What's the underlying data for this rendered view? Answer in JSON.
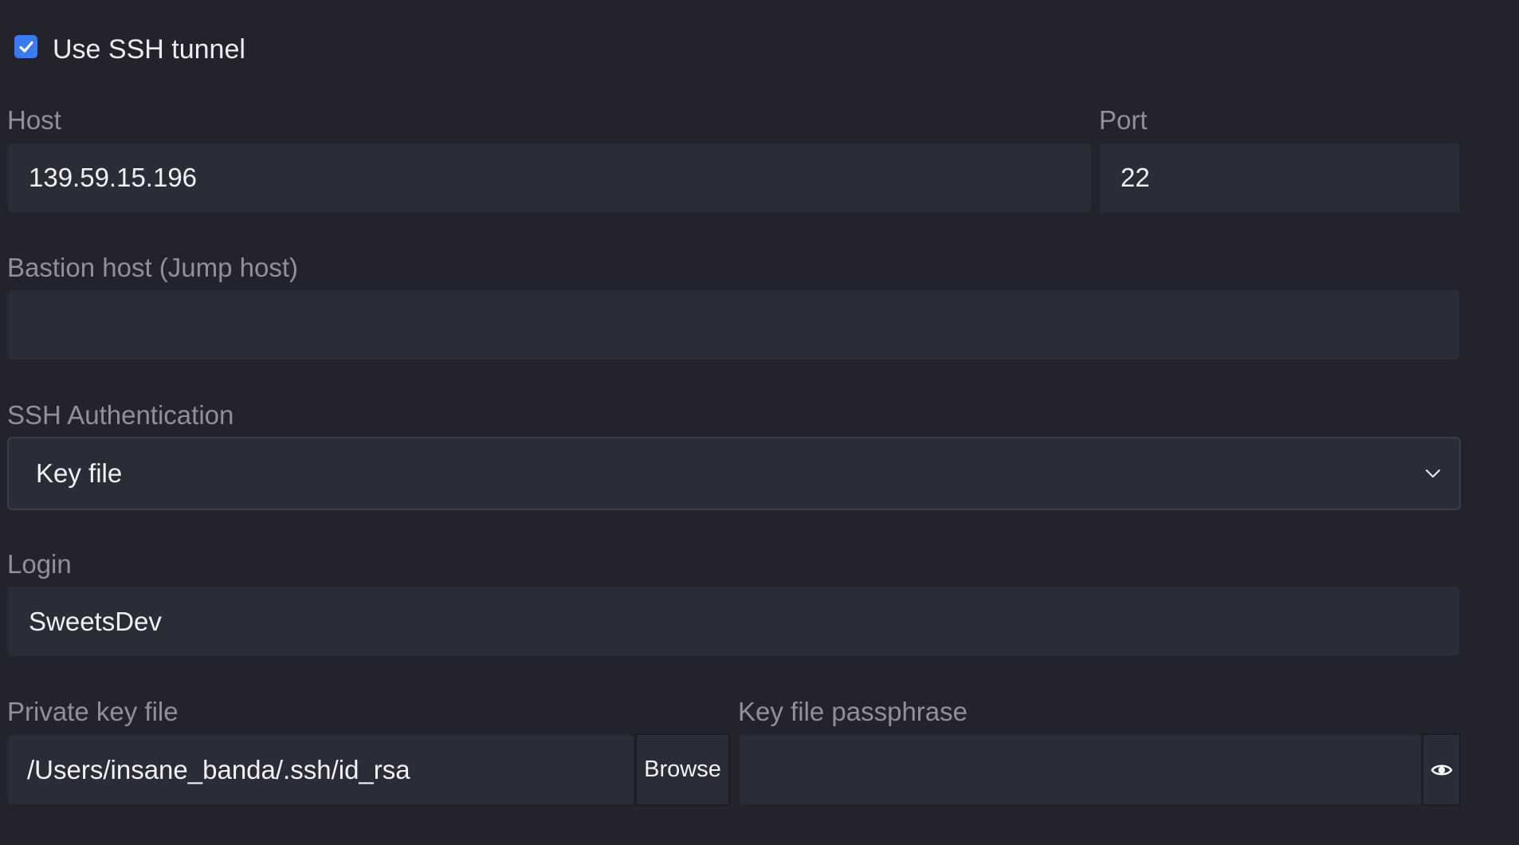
{
  "ssh_tunnel": {
    "checkbox_label": "Use SSH tunnel",
    "checked": true
  },
  "host": {
    "label": "Host",
    "value": "139.59.15.196"
  },
  "port": {
    "label": "Port",
    "value": "22"
  },
  "bastion": {
    "label": "Bastion host (Jump host)",
    "value": ""
  },
  "auth": {
    "label": "SSH Authentication",
    "selected": "Key file"
  },
  "login": {
    "label": "Login",
    "value": "SweetsDev"
  },
  "private_key": {
    "label": "Private key file",
    "value": "/Users/insane_banda/.ssh/id_rsa",
    "browse_label": "Browse"
  },
  "passphrase": {
    "label": "Key file passphrase",
    "value": ""
  },
  "icons": {
    "checkbox": "checkmark-icon",
    "select": "chevron-down-icon",
    "reveal": "eye-icon"
  },
  "colors": {
    "accent": "#3b7bf0",
    "background": "#22232d",
    "field_background": "#2a2c38"
  }
}
